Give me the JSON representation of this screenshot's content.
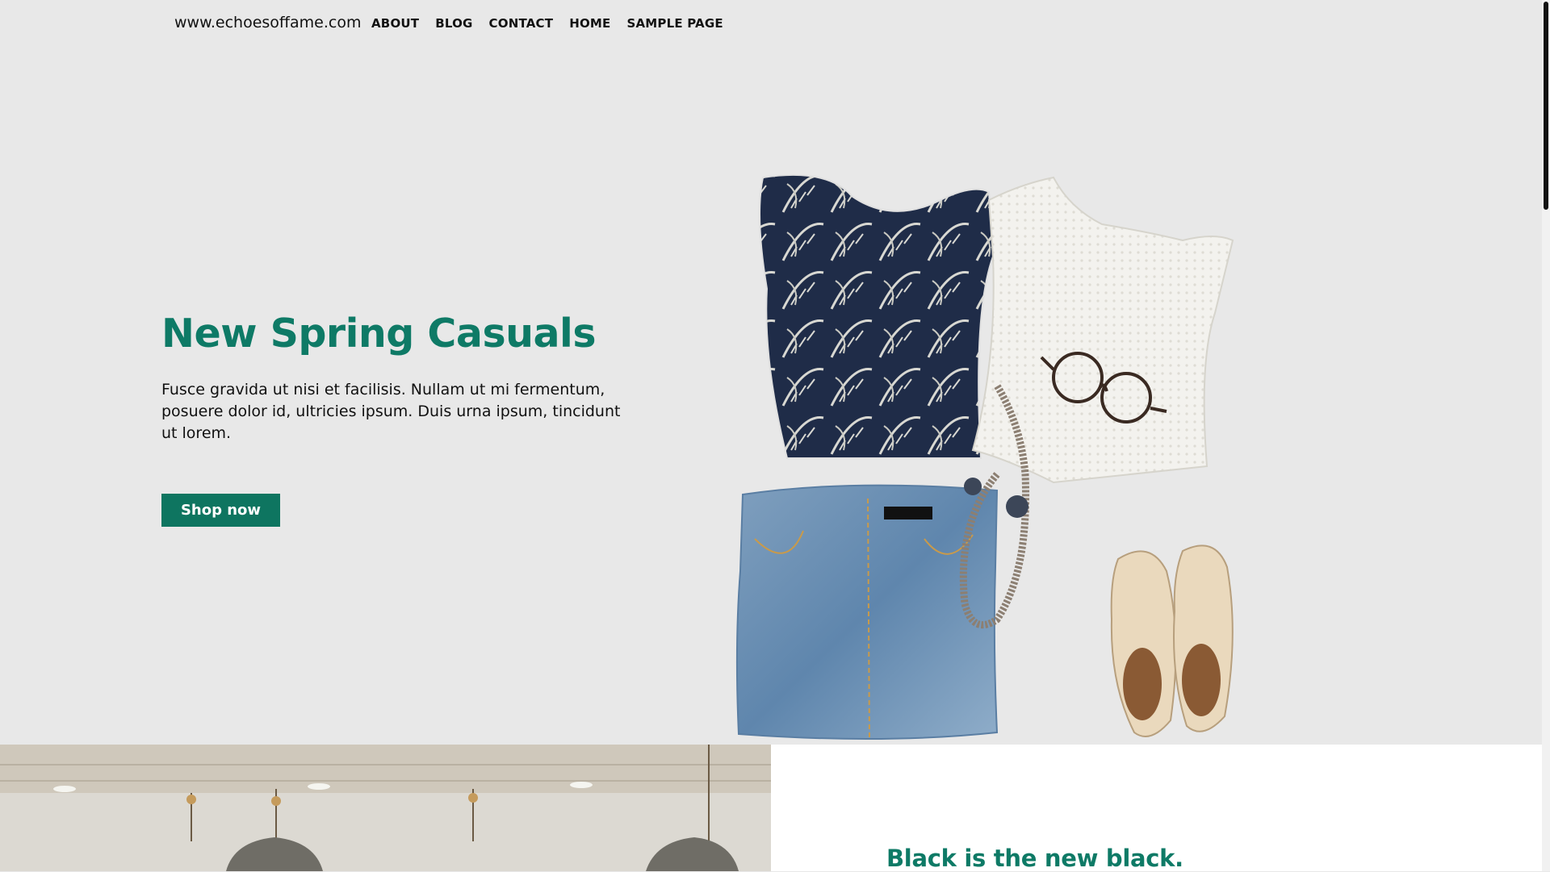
{
  "header": {
    "site_title": "www.echoesoffame.com",
    "nav": [
      "ABOUT",
      "BLOG",
      "CONTACT",
      "HOME",
      "SAMPLE PAGE"
    ]
  },
  "hero": {
    "title": "New Spring Casuals",
    "text": "Fusce gravida ut nisi et facilisis. Nullam ut mi fermentum, posuere dolor id, ultricies ipsum. Duis urna ipsum, tincidunt ut lorem.",
    "button_label": "Shop now",
    "image_icon": "clothing-flatlay-image"
  },
  "promo": {
    "title": "Black is the new black.",
    "image_icon": "store-interior-image"
  },
  "colors": {
    "accent": "#0e7a66",
    "button": "#0e7560",
    "background": "#e8e8e8"
  }
}
